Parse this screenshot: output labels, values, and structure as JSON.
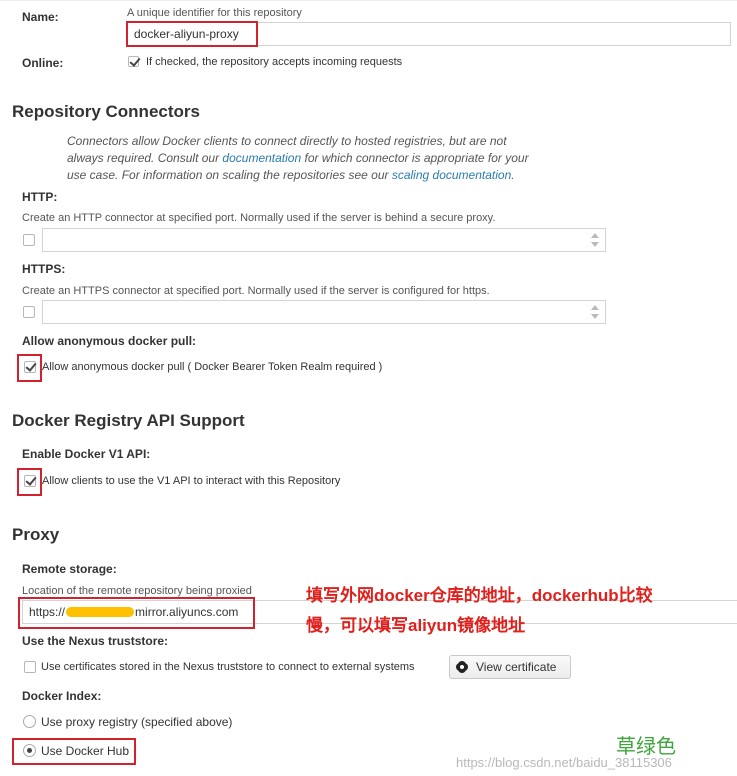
{
  "name_field": {
    "label": "Name:",
    "help": "A unique identifier for this repository",
    "value": "docker-aliyun-proxy"
  },
  "online": {
    "label": "Online:",
    "checkbox_text": "If checked, the repository accepts incoming requests",
    "checked": true
  },
  "connectors": {
    "title": "Repository Connectors",
    "intro_1": "Connectors allow Docker clients to connect directly to hosted registries, but are not",
    "intro_2a": "always required. Consult our ",
    "intro_link_1": "documentation",
    "intro_2b": " for which connector is appropriate for your",
    "intro_3a": "use case. For information on scaling the repositories see our ",
    "intro_link_2": "scaling documentation",
    "intro_3b": ".",
    "http": {
      "label": "HTTP:",
      "help": "Create an HTTP connector at specified port. Normally used if the server is behind a secure proxy."
    },
    "https": {
      "label": "HTTPS:",
      "help": "Create an HTTPS connector at specified port. Normally used if the server is configured for https."
    },
    "anon": {
      "label": "Allow anonymous docker pull:",
      "checkbox_text": "Allow anonymous docker pull ( Docker Bearer Token Realm required )"
    }
  },
  "api": {
    "title": "Docker Registry API Support",
    "label": "Enable Docker V1 API:",
    "checkbox_text": "Allow clients to use the V1 API to interact with this Repository"
  },
  "proxy": {
    "title": "Proxy",
    "remote_label": "Remote storage:",
    "remote_help": "Location of the remote repository being proxied",
    "remote_prefix": "https://",
    "remote_suffix": "mirror.aliyuncs.com",
    "truststore_label": "Use the Nexus truststore:",
    "truststore_text": "Use certificates stored in the Nexus truststore to connect to external systems",
    "view_cert": "View certificate",
    "index_label": "Docker Index:",
    "index_option_1": "Use proxy registry (specified above)",
    "index_option_2": "Use Docker Hub"
  },
  "annotation": {
    "line1": "填写外网docker仓库的地址，dockerhub比较",
    "line2": "慢，可以填写aliyun镜像地址",
    "color": "#e0201c"
  },
  "grass_note": "草绿色",
  "watermark": "https://blog.csdn.net/baidu_38115306",
  "colors": {
    "highlight": "#d0232f",
    "link": "#2a7ab0",
    "grass": "#3ea53c",
    "redaction": "#ffc000"
  }
}
